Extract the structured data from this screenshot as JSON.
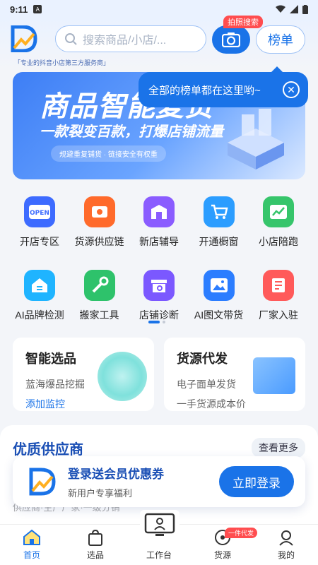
{
  "status": {
    "time": "9:11"
  },
  "header": {
    "tagline": "「专业的抖音小店第三方服务商」",
    "search_placeholder": "搜索商品/小店/...",
    "photo_search_badge": "拍照搜索",
    "rank_label": "榜单"
  },
  "banner": {
    "title": "商品智能复货",
    "subtitle": "一款裂变百款，打爆店铺流量",
    "pill": "规避重复铺货 · 链接安全有权重"
  },
  "tooltip": {
    "text": "全部的榜单都在这里哟~"
  },
  "grid": [
    {
      "label": "开店专区",
      "icon": "open-shop-icon",
      "color": "#3d6bff"
    },
    {
      "label": "货源供应链",
      "icon": "supply-chain-icon",
      "color": "#ff6a2b"
    },
    {
      "label": "新店辅导",
      "icon": "new-store-guide-icon",
      "color": "#8a5cff"
    },
    {
      "label": "开通橱窗",
      "icon": "cart-icon",
      "color": "#2b9dff"
    },
    {
      "label": "小店陪跑",
      "icon": "chart-icon",
      "color": "#36c56b"
    },
    {
      "label": "AI品牌检测",
      "icon": "home-check-icon",
      "color": "#1fb4ff"
    },
    {
      "label": "搬家工具",
      "icon": "wrench-icon",
      "color": "#2ec26b"
    },
    {
      "label": "店铺诊断",
      "icon": "store-diagnosis-icon",
      "color": "#7b58ff"
    },
    {
      "label": "AI图文带货",
      "icon": "image-icon",
      "color": "#2b7dff"
    },
    {
      "label": "厂家入驻",
      "icon": "factory-icon",
      "color": "#ff5a5a"
    }
  ],
  "cards": {
    "left": {
      "title": "智能选品",
      "sub": "蓝海爆品挖掘",
      "link": "添加监控"
    },
    "right": {
      "title": "货源代发",
      "sub": "电子面单发货",
      "sub2": "一手货源成本价"
    }
  },
  "suppliers": {
    "title": "优质供应商",
    "more": "查看更多",
    "bg_text": "供应商·生产厂家·一级分销"
  },
  "login": {
    "line1": "登录送会员优惠券",
    "line2": "新用户专享福利",
    "button": "立即登录"
  },
  "nav": [
    {
      "label": "首页",
      "icon": "home-icon",
      "active": true
    },
    {
      "label": "选品",
      "icon": "shopping-bag-icon"
    },
    {
      "label": "工作台",
      "icon": "workstation-icon"
    },
    {
      "label": "货源",
      "icon": "supply-icon",
      "badge": "一件代发"
    },
    {
      "label": "我的",
      "icon": "profile-icon"
    }
  ]
}
